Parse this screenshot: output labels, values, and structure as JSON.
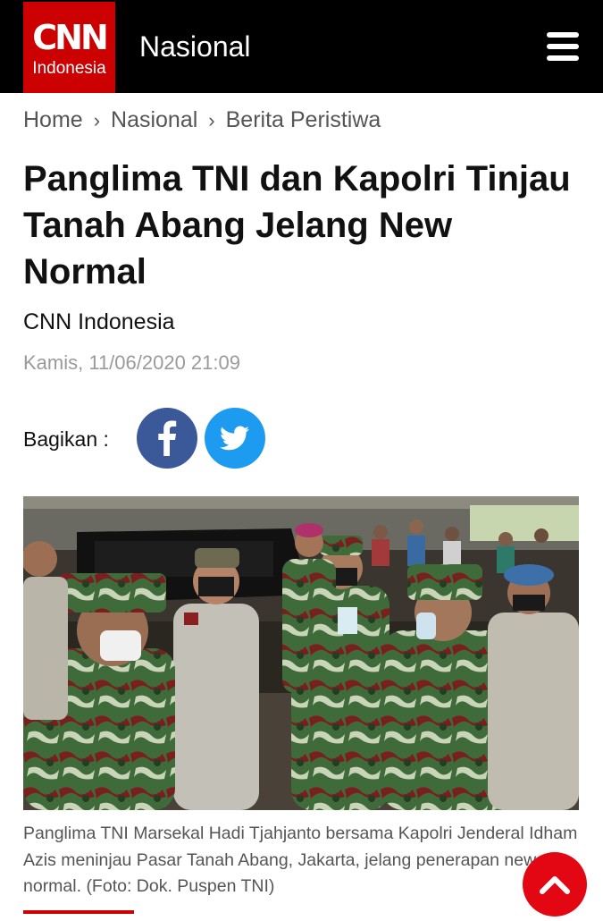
{
  "header": {
    "logo_text": "CNN",
    "logo_sub": "Indonesia",
    "section": "Nasional"
  },
  "breadcrumb": [
    "Home",
    "Nasional",
    "Berita Peristiwa"
  ],
  "article": {
    "title": "Panglima TNI dan Kapolri Tinjau Tanah Abang Jelang New Normal",
    "author": "CNN Indonesia",
    "date": "Kamis, 11/06/2020 21:09",
    "share_label": "Bagikan :",
    "caption": "Panglima TNI Marsekal Hadi Tjahjanto bersama Kapolri Jenderal Idham Azis meninjau Pasar Tanah Abang, Jakarta, jelang penerapan new normal. (Foto: Dok. Puspen TNI)"
  },
  "colors": {
    "brand_red": "#cc0000",
    "facebook": "#3b5998",
    "twitter": "#1d9bf0",
    "scroll_top": "#e30613"
  },
  "icons": [
    "menu-icon",
    "chevron-right-icon",
    "facebook-icon",
    "twitter-icon",
    "chevron-up-icon"
  ]
}
